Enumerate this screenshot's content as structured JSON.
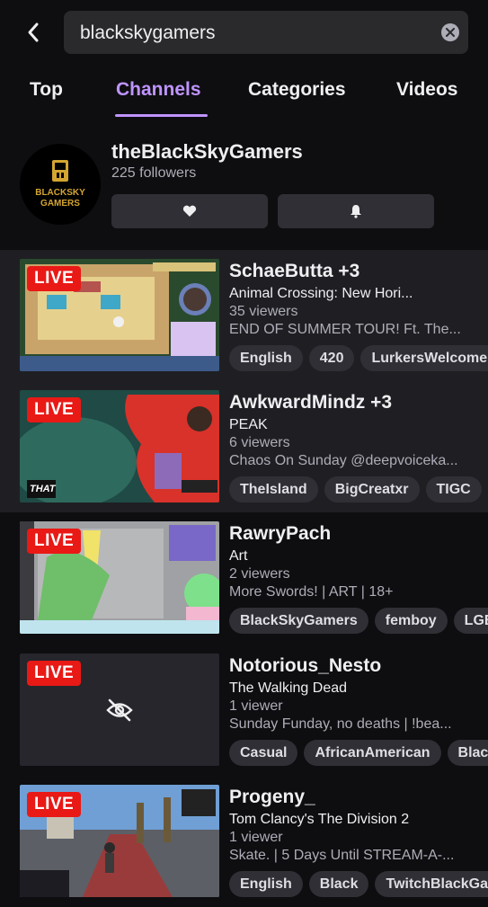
{
  "search": {
    "query": "blackskygamers"
  },
  "tabs": [
    {
      "label": "Top"
    },
    {
      "label": "Channels"
    },
    {
      "label": "Categories"
    },
    {
      "label": "Videos"
    }
  ],
  "active_tab": "Channels",
  "channel": {
    "name": "theBlackSkyGamers",
    "followers": "225 followers",
    "logo_line1": "BLACKSKY",
    "logo_line2": "GAMERS"
  },
  "streams": [
    {
      "live_label": "LIVE",
      "name": "SchaeButta +3",
      "game": "Animal Crossing: New Hori...",
      "viewers": "35 viewers",
      "title": "END OF SUMMER TOUR! Ft. The...",
      "tags": [
        "English",
        "420",
        "LurkersWelcome"
      ]
    },
    {
      "live_label": "LIVE",
      "name": "AwkwardMindz +3",
      "game": "PEAK",
      "viewers": "6 viewers",
      "title": "Chaos On Sunday @deepvoiceka...",
      "tags": [
        "TheIsland",
        "BigCreatxr",
        "TIGC"
      ],
      "thumb_text": "THAT"
    },
    {
      "live_label": "LIVE",
      "name": "RawryPach",
      "game": "Art",
      "viewers": "2 viewers",
      "title": "More Swords! | ART | 18+",
      "tags": [
        "BlackSkyGamers",
        "femboy",
        "LGBTQ"
      ]
    },
    {
      "live_label": "LIVE",
      "name": "Notorious_Nesto",
      "game": "The Walking Dead",
      "viewers": "1 viewer",
      "title": "Sunday Funday, no deaths | !bea...",
      "tags": [
        "Casual",
        "AfricanAmerican",
        "Black"
      ]
    },
    {
      "live_label": "LIVE",
      "name": "Progeny_",
      "game": "Tom Clancy's The Division 2",
      "viewers": "1 viewer",
      "title": "Skate. | 5 Days Until STREAM-A-...",
      "tags": [
        "English",
        "Black",
        "TwitchBlackGaming"
      ]
    }
  ],
  "colors": {
    "background": "#0e0e10",
    "accent": "#bf94ff",
    "live": "#e91916",
    "tag_bg": "#2f2f35"
  },
  "icons": {
    "back": "chevron-left-icon",
    "clear": "close-circle-icon",
    "follow": "heart-icon",
    "notify": "bell-icon",
    "hidden": "eye-slash-icon"
  }
}
